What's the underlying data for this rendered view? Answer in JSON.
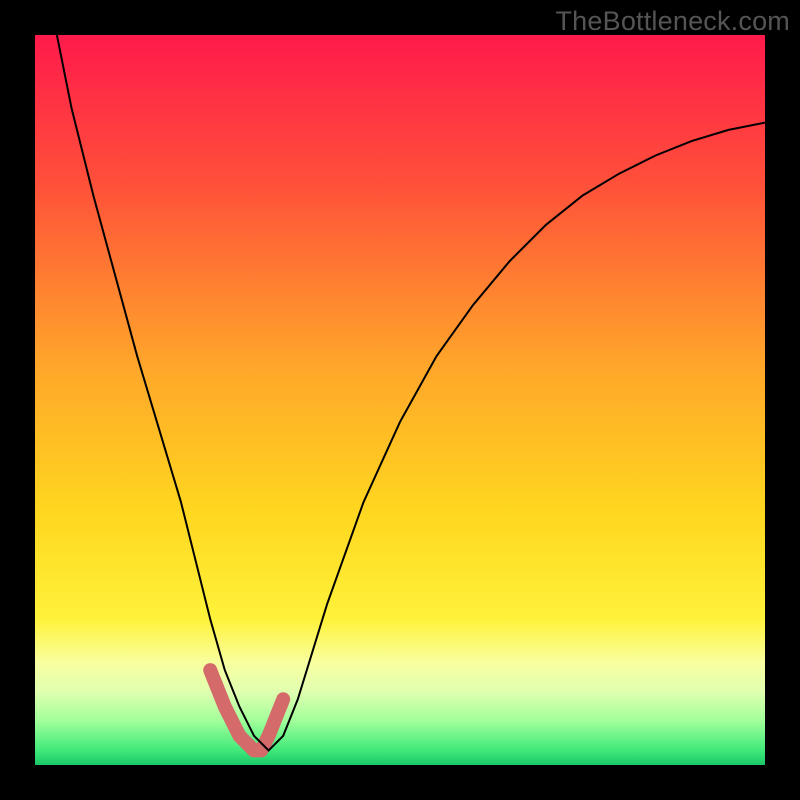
{
  "watermark": "TheBottleneck.com",
  "chart_data": {
    "type": "line",
    "title": "",
    "xlabel": "",
    "ylabel": "",
    "xlim": [
      0,
      100
    ],
    "ylim": [
      0,
      100
    ],
    "grid": false,
    "legend": false,
    "annotations": [],
    "gradient_stops": [
      {
        "offset": 0,
        "color": "#ff1a4b"
      },
      {
        "offset": 0.2,
        "color": "#ff4f3a"
      },
      {
        "offset": 0.45,
        "color": "#ffa52a"
      },
      {
        "offset": 0.65,
        "color": "#ffd61f"
      },
      {
        "offset": 0.8,
        "color": "#fff23a"
      },
      {
        "offset": 0.86,
        "color": "#f8ffa0"
      },
      {
        "offset": 0.9,
        "color": "#e0ffb0"
      },
      {
        "offset": 0.94,
        "color": "#a0ff9a"
      },
      {
        "offset": 0.98,
        "color": "#40e97a"
      },
      {
        "offset": 1.0,
        "color": "#18c768"
      }
    ],
    "series": [
      {
        "name": "bottleneck-curve",
        "color": "#000000",
        "width": 2,
        "x": [
          3,
          5,
          8,
          11,
          14,
          17,
          20,
          22,
          24,
          26,
          28,
          30,
          32,
          34,
          36,
          40,
          45,
          50,
          55,
          60,
          65,
          70,
          75,
          80,
          85,
          90,
          95,
          100
        ],
        "values": [
          100,
          90,
          78,
          67,
          56,
          46,
          36,
          28,
          20,
          13,
          8,
          4,
          2,
          4,
          9,
          22,
          36,
          47,
          56,
          63,
          69,
          74,
          78,
          81,
          83.5,
          85.5,
          87,
          88
        ]
      },
      {
        "name": "highlight-dip",
        "color": "#d46a6a",
        "width": 14,
        "linecap": "round",
        "x": [
          24,
          26,
          28,
          30,
          31,
          32,
          34
        ],
        "values": [
          13,
          8,
          4,
          2,
          2,
          4,
          9
        ]
      }
    ]
  }
}
